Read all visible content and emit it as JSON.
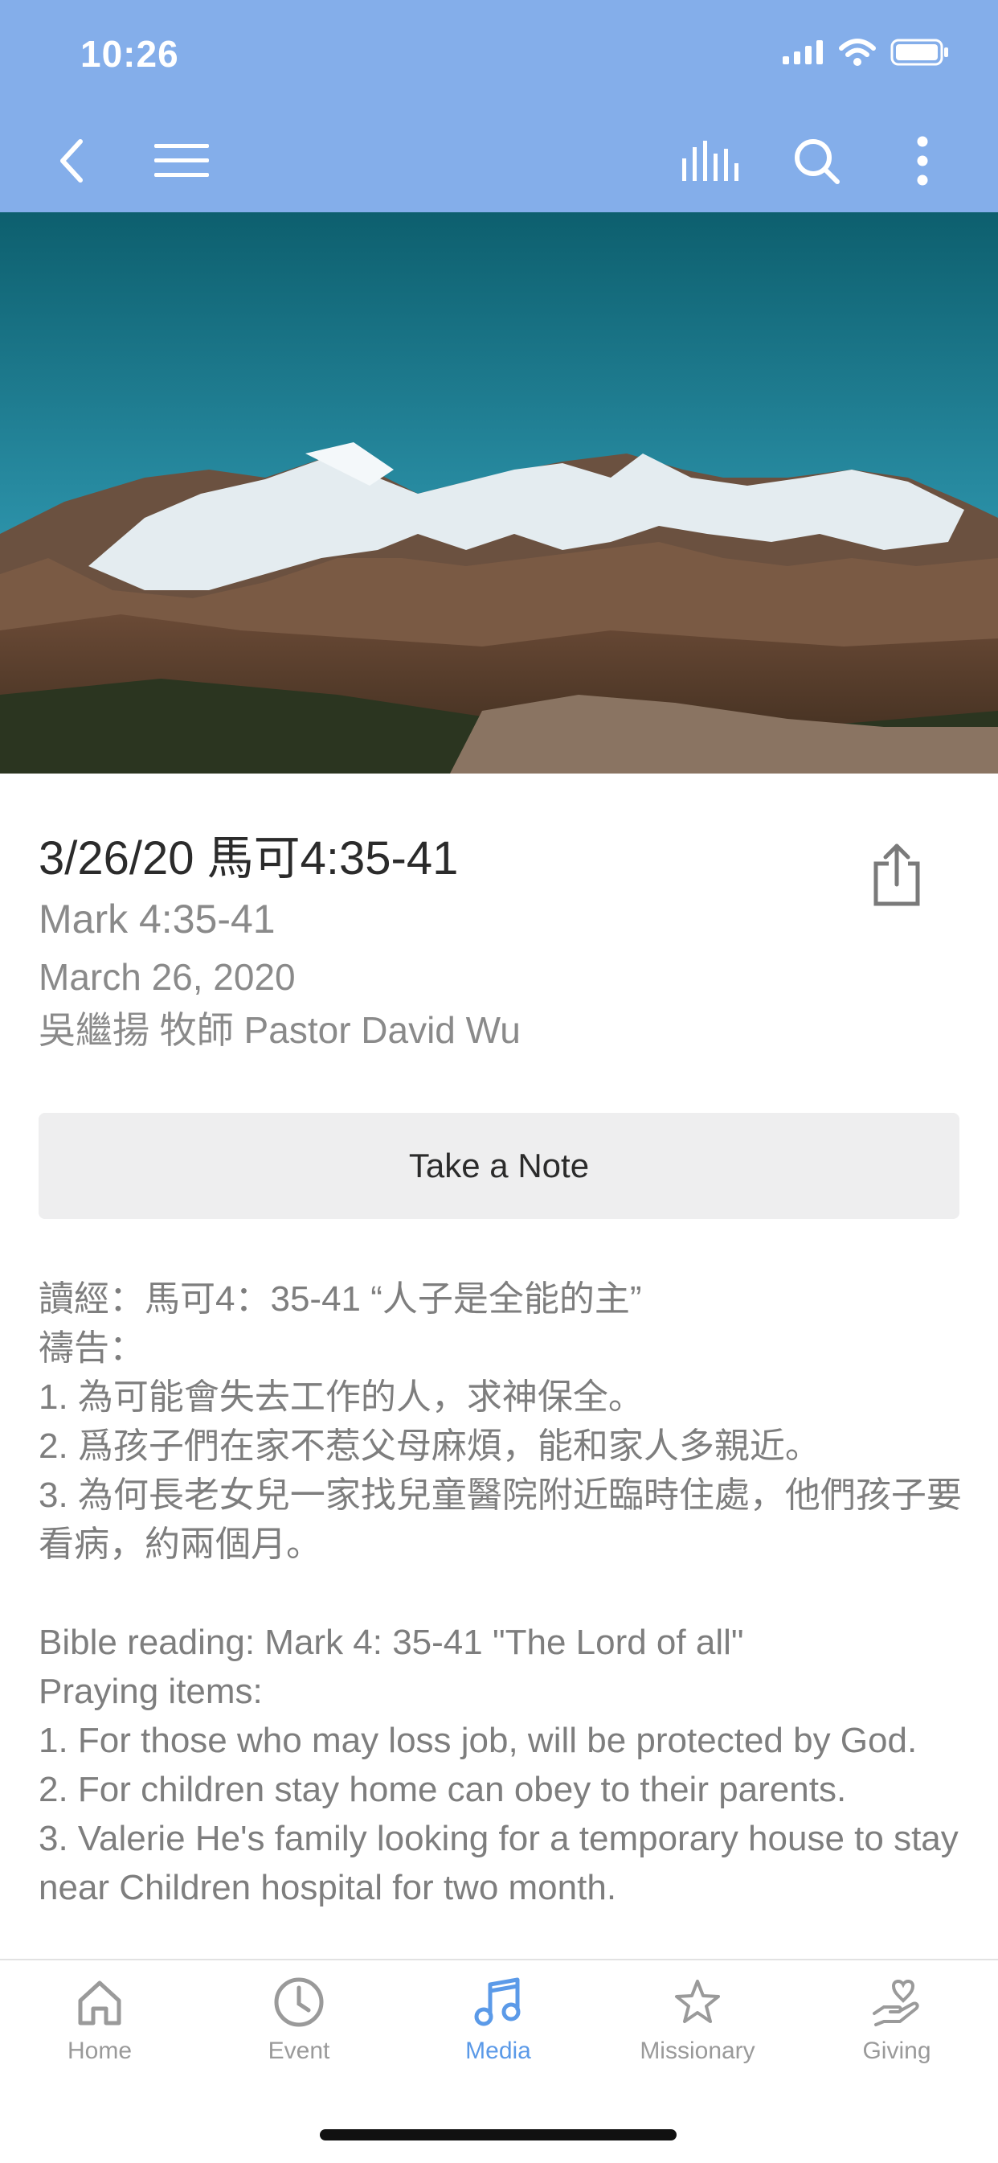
{
  "status": {
    "time": "10:26"
  },
  "header": {
    "back_icon": "chevron-left-icon",
    "menu_icon": "hamburger-menu-icon",
    "audio_icon": "audio-bars-icon",
    "search_icon": "search-icon",
    "more_icon": "vertical-ellipsis-icon",
    "background_color": "#84aeea"
  },
  "sermon": {
    "title": "3/26/20 馬可4:35-41",
    "subtitle": "Mark 4:35-41",
    "date": "March 26, 2020",
    "speaker": "吳繼揚 牧師 Pastor David Wu"
  },
  "actions": {
    "take_note_label": "Take a Note",
    "share_icon": "share-icon"
  },
  "notes": {
    "zh_lines": [
      "讀經：馬可4：35-41 “人子是全能的主”",
      "禱告：",
      "1. 為可能會失去工作的人，求神保全。",
      "2. 爲孩子們在家不惹父母麻煩，能和家人多親近。",
      "3. 為何長老女兒一家找兒童醫院附近臨時住處，他們孩子要看病，約兩個月。"
    ],
    "en_lines": [
      "Bible reading: Mark 4: 35-41 \"The Lord of all\"",
      "Praying items:",
      "1. For those who may loss job, will be protected by God.",
      "2. For children stay home can obey to their parents.",
      "3. Valerie He's family looking for a temporary house to stay near Children hospital for two month."
    ]
  },
  "tabs": [
    {
      "label": "Home",
      "icon": "home-icon"
    },
    {
      "label": "Event",
      "icon": "clock-icon"
    },
    {
      "label": "Media",
      "icon": "music-note-icon",
      "active": true
    },
    {
      "label": "Missionary",
      "icon": "star-icon"
    },
    {
      "label": "Giving",
      "icon": "hand-heart-icon"
    }
  ],
  "colors": {
    "accent": "#5b9ae8",
    "inactive": "#9a9a9a"
  }
}
